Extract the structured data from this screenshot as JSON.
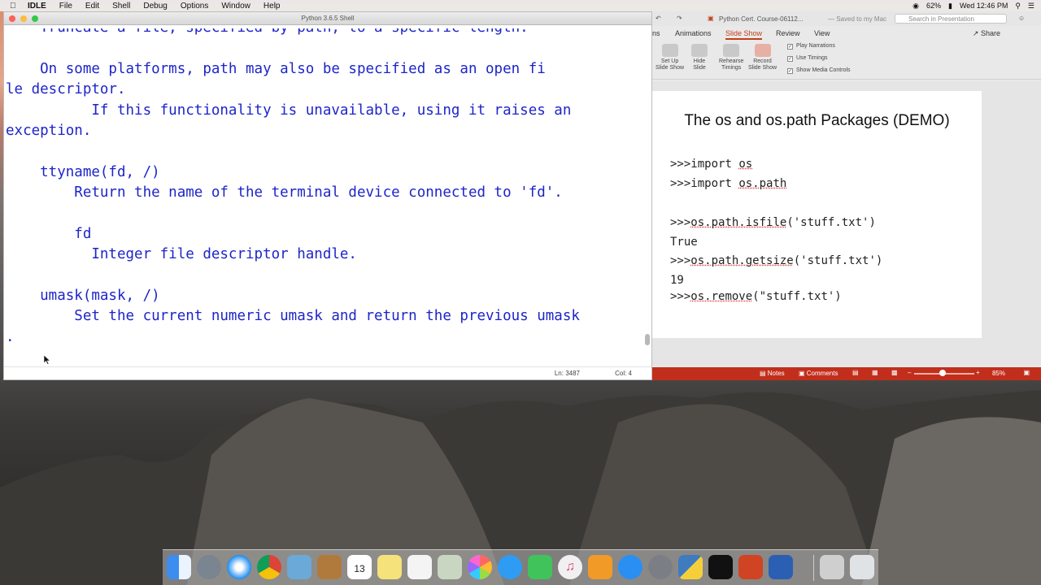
{
  "menubar": {
    "app": "IDLE",
    "items": [
      "File",
      "Edit",
      "Shell",
      "Debug",
      "Options",
      "Window",
      "Help"
    ],
    "battery": "62%",
    "clock": "Wed 12:46 PM"
  },
  "idle": {
    "window_title": "Python 3.6.5 Shell",
    "lines": [
      "    Truncate a file, specified by path, to a specific length.",
      "",
      "    On some platforms, path may also be specified as an open fi",
      "le descriptor.",
      "          If this functionality is unavailable, using it raises an",
      "exception.",
      "",
      "    ttyname(fd, /)",
      "        Return the name of the terminal device connected to 'fd'.",
      "",
      "        fd",
      "          Integer file descriptor handle.",
      "",
      "    umask(mask, /)",
      "        Set the current numeric umask and return the previous umask",
      "."
    ],
    "status": {
      "ln": "Ln: 3487",
      "col": "Col: 4"
    }
  },
  "ppt": {
    "doc_title": "Python Cert. Course-06112...",
    "saved": "— Saved to my Mac",
    "search_placeholder": "Search in Presentation",
    "tabs": [
      "ns",
      "Animations",
      "Slide Show",
      "Review",
      "View"
    ],
    "active_tab": "Slide Show",
    "share": "Share",
    "ribbon": {
      "set_up": [
        "Set Up",
        "Slide Show"
      ],
      "hide": [
        "Hide",
        "Slide"
      ],
      "rehearse": [
        "Rehearse",
        "Timings"
      ],
      "record": [
        "Record",
        "Slide Show"
      ],
      "checks": [
        "Play Narrations",
        "Use Timings",
        "Show Media Controls"
      ]
    },
    "slide": {
      "title": "The os and os.path Packages (DEMO)",
      "lines": [
        {
          "prefix": ">>>",
          "pre": "import ",
          "u": "os",
          "post": ""
        },
        {
          "prefix": ">>>",
          "pre": "import ",
          "u": "os.path",
          "post": ""
        },
        {
          "prefix": ">>>",
          "pre": "",
          "u": "os.path.isfile",
          "post": "('stuff.txt')"
        },
        {
          "prefix": "",
          "pre": "True",
          "u": "",
          "post": ""
        },
        {
          "prefix": ">>>",
          "pre": "",
          "u": "os.path.getsize",
          "post": "('stuff.txt')"
        },
        {
          "prefix": "",
          "pre": "19",
          "u": "",
          "post": ""
        },
        {
          "prefix": ">>>",
          "pre": "",
          "u": "os.remove",
          "post": "(\"stuff.txt')"
        }
      ]
    },
    "statusbar": {
      "notes": "Notes",
      "comments": "Comments",
      "zoom": "85%"
    }
  },
  "dock": {
    "calendar_day": "13",
    "apps": [
      "finder-icon",
      "launchpad-icon",
      "safari-icon",
      "chrome-icon",
      "preview-icon",
      "notes-book-icon",
      "calendar-icon",
      "stickies-icon",
      "reminders-icon",
      "photos-viewer-icon",
      "photos-icon",
      "messages-icon",
      "facetime-icon",
      "itunes-icon",
      "ibooks-icon",
      "appstore-icon",
      "system-preferences-icon",
      "python-icon",
      "terminal-icon",
      "powerpoint-icon",
      "word-icon"
    ]
  }
}
